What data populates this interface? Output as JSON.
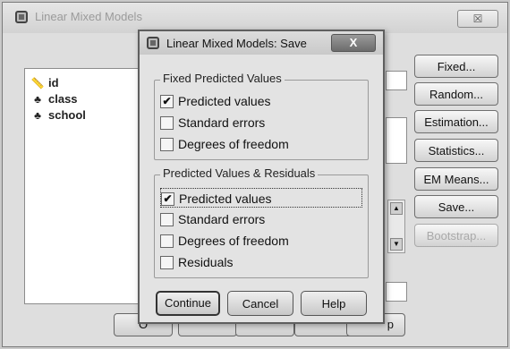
{
  "outer_window": {
    "title": "Linear Mixed Models",
    "close": "☒",
    "variables": [
      {
        "name": "id",
        "icon": "ruler-icon"
      },
      {
        "name": "class",
        "icon": "nominal-icon"
      },
      {
        "name": "school",
        "icon": "nominal-icon"
      }
    ],
    "right_buttons": [
      "Fixed...",
      "Random...",
      "Estimation...",
      "Statistics...",
      "EM Means...",
      "Save...",
      "Bootstrap..."
    ],
    "bottom_partial": [
      "O",
      "p"
    ]
  },
  "dialog": {
    "title": "Linear Mixed Models: Save",
    "close": "X",
    "fixed_group": {
      "legend": "Fixed Predicted Values",
      "items": [
        {
          "label": "Predicted values",
          "checked": true
        },
        {
          "label": "Standard errors",
          "checked": false
        },
        {
          "label": "Degrees of freedom",
          "checked": false
        }
      ]
    },
    "residual_group": {
      "legend": "Predicted Values & Residuals",
      "items": [
        {
          "label": "Predicted values",
          "checked": true
        },
        {
          "label": "Standard errors",
          "checked": false
        },
        {
          "label": "Degrees of freedom",
          "checked": false
        },
        {
          "label": "Residuals",
          "checked": false
        }
      ]
    },
    "buttons": {
      "continue": "Continue",
      "cancel": "Cancel",
      "help": "Help"
    }
  }
}
